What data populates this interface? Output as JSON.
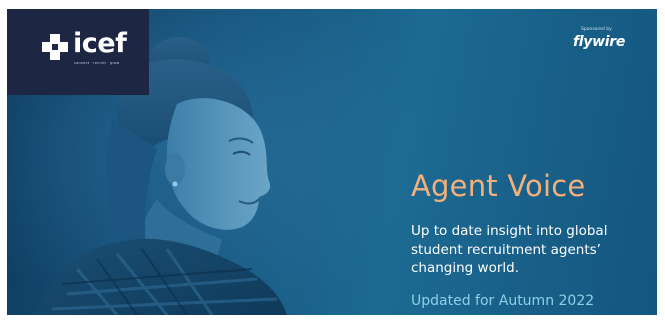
{
  "brand": {
    "logo_word": "icef",
    "logo_tagline": "connect · recruit · grow",
    "logo_icon": "icef-cross-icon"
  },
  "sponsor": {
    "label": "Sponsored by",
    "name": "flywire"
  },
  "hero": {
    "title": "Agent Voice",
    "description": "Up to date insight into global student recruitment agents’ changing world.",
    "updated": "Updated for Autumn 2022"
  },
  "colors": {
    "background": "#17527a",
    "logo_panel": "#1d2642",
    "title": "#f3b07a",
    "updated": "#8fd0e8",
    "text": "#ffffff"
  }
}
